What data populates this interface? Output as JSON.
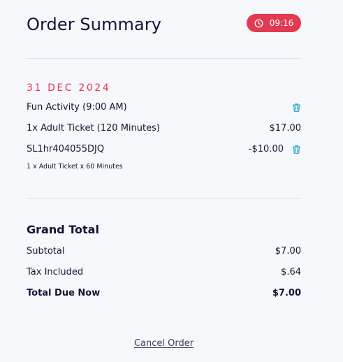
{
  "header": {
    "title": "Order Summary",
    "timer": "09:16"
  },
  "order": {
    "date": "31 DEC 2024",
    "activity": "Fun Activity (9:00 AM)",
    "ticket_label": "1x Adult Ticket (120 Minutes)",
    "ticket_price": "$17.00",
    "promo_code": "SL1hr404055DJQ",
    "promo_amount": "-$10.00",
    "promo_note": "1 x Adult Ticket x 60 Minutes"
  },
  "totals": {
    "heading": "Grand Total",
    "subtotal_label": "Subtotal",
    "subtotal_value": "$7.00",
    "tax_label": "Tax Included",
    "tax_value": "$.64",
    "due_label": "Total Due Now",
    "due_value": "$7.00"
  },
  "actions": {
    "cancel_label": "Cancel Order"
  },
  "colors": {
    "accent": "#e23a50",
    "icon": "#1aa0c8",
    "text": "#111436",
    "background": "#f7f8fc"
  },
  "icons": {
    "timer": "clock-icon",
    "delete": "trash-icon"
  }
}
